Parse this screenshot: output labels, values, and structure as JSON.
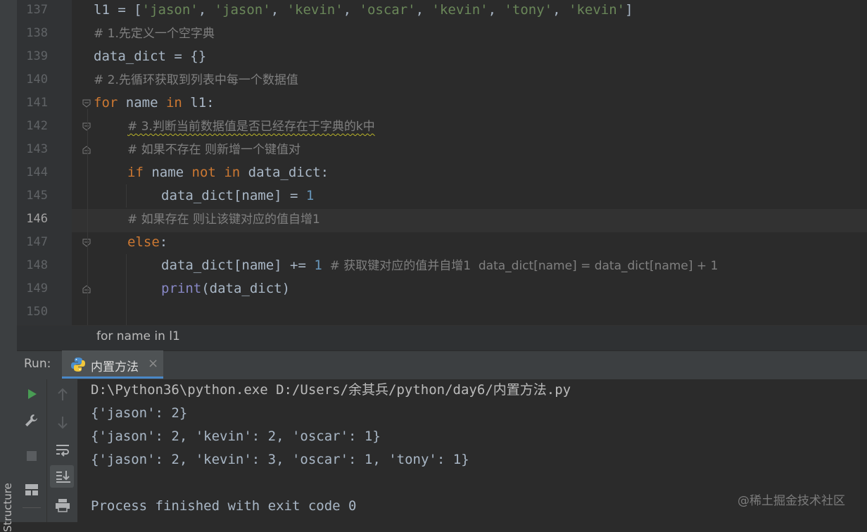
{
  "editor": {
    "current_line": 146,
    "line_numbers": [
      "137",
      "138",
      "139",
      "140",
      "141",
      "142",
      "143",
      "144",
      "145",
      "146",
      "147",
      "148",
      "149",
      "150"
    ],
    "lines": {
      "l137": {
        "a": "l1 = [",
        "s1": "'jason'",
        "c1": ", ",
        "s2": "'jason'",
        "c2": ", ",
        "s3": "'kevin'",
        "c3": ", ",
        "s4": "'oscar'",
        "c4": ", ",
        "s5": "'kevin'",
        "c5": ", ",
        "s6": "'tony'",
        "c6": ", ",
        "s7": "'kevin'",
        "z": "]"
      },
      "l138": {
        "comment": "# 1.先定义一个空字典"
      },
      "l139": {
        "code": "data_dict = {}"
      },
      "l140": {
        "comment": "# 2.先循环获取到列表中每一个数据值"
      },
      "l141": {
        "kw1": "for",
        "a": " name ",
        "kw2": "in",
        "b": " l1:"
      },
      "l142": {
        "comment": "# 3.判断当前数据值是否已经存在于字典的k中"
      },
      "l143": {
        "comment": "# 如果不存在 则新增一个键值对"
      },
      "l144": {
        "kw1": "if",
        "a": " name ",
        "kw2": "not",
        "sp": " ",
        "kw3": "in",
        "b": " data_dict:"
      },
      "l145": {
        "a": "data_dict[name] = ",
        "num": "1"
      },
      "l146": {
        "comment": "# 如果存在 则让该键对应的值自增1"
      },
      "l147": {
        "kw": "else",
        ":": ":"
      },
      "l148": {
        "a": "data_dict[name] += ",
        "num": "1",
        "comment": "  # 获取键对应的值并自增1  data_dict[name] = data_dict[name] + 1"
      },
      "l149": {
        "fn": "print",
        "a": "(data_dict)"
      }
    }
  },
  "breadcrumb": "for name in l1",
  "side_tab": "Structure",
  "run_panel": {
    "label": "Run:",
    "tab_label": "内置方法",
    "close_glyph": "×",
    "console_lines": [
      "D:\\Python36\\python.exe D:/Users/余其兵/python/day6/内置方法.py",
      "{'jason': 2}",
      "{'jason': 2, 'kevin': 2, 'oscar': 1}",
      "{'jason': 2, 'kevin': 3, 'oscar': 1, 'tony': 1}",
      "",
      "Process finished with exit code 0"
    ],
    "toolbar_icons": [
      "run-icon",
      "wrench-icon",
      "stop-icon",
      "layout-icon",
      "up-arrow-icon",
      "down-arrow-icon",
      "soft-wrap-icon",
      "scroll-to-end-icon",
      "print-icon"
    ]
  },
  "watermark": "@稀土掘金技术社区",
  "colors": {
    "background": "#2b2b2b",
    "keyword": "#cc7832",
    "string": "#6a8759",
    "number": "#6897bb",
    "comment": "#808080",
    "builtin": "#8888c6",
    "run_green": "#499c54"
  }
}
